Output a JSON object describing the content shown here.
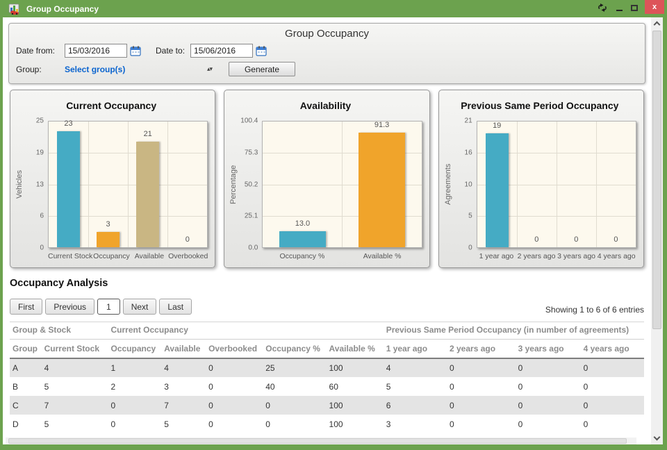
{
  "window": {
    "title": "Group Occupancy",
    "close_glyph": "x"
  },
  "icons": {
    "app": "bar-chart-with-car",
    "sync": "sync-arrows",
    "minimize": "minimize-dash",
    "maximize": "maximize-square",
    "close": "close-x",
    "calendar": "calendar",
    "select_spinner": "up-down-arrows",
    "scroll_up": "chevron-up",
    "scroll_down": "chevron-down"
  },
  "form": {
    "title": "Group Occupancy",
    "date_from_label": "Date from:",
    "date_from_value": "15/03/2016",
    "date_to_label": "Date to:",
    "date_to_value": "15/06/2016",
    "group_label": "Group:",
    "group_value": "Select group(s)",
    "spinner_glyph": "▴▾",
    "generate_label": "Generate"
  },
  "colors": {
    "titlebar_green": "#6ca24e",
    "close_red": "#dd5459",
    "teal": "#45abc4",
    "orange": "#f0a42b",
    "tan": "#c9b683",
    "plot_bg": "#fdf9ee",
    "link_blue": "#0b64cf",
    "row_alt": "#e4e4e4"
  },
  "chart_data": [
    {
      "type": "bar",
      "title": "Current Occupancy",
      "ylabel": "Vehicles",
      "categories": [
        "Current Stock",
        "Occupancy",
        "Available",
        "Overbooked"
      ],
      "values": [
        23,
        3,
        21,
        0
      ],
      "value_labels": [
        "23",
        "3",
        "21",
        "0"
      ],
      "colors": [
        "#45abc4",
        "#f0a42b",
        "#c9b683",
        "#45abc4"
      ],
      "ymax": 25,
      "ytick_labels": [
        "25",
        "19",
        "13",
        "6",
        "0"
      ],
      "grid": true,
      "legend": false
    },
    {
      "type": "bar",
      "title": "Availability",
      "ylabel": "Percentage",
      "categories": [
        "Occupancy %",
        "Available %"
      ],
      "values": [
        13.0,
        91.3
      ],
      "value_labels": [
        "13.0",
        "91.3"
      ],
      "colors": [
        "#45abc4",
        "#f0a42b"
      ],
      "ymax": 100.4,
      "ytick_labels": [
        "100.4",
        "75.3",
        "50.2",
        "25.1",
        "0.0"
      ],
      "grid": true,
      "legend": false
    },
    {
      "type": "bar",
      "title": "Previous Same Period Occupancy",
      "ylabel": "Agreements",
      "categories": [
        "1 year ago",
        "2 years ago",
        "3 years ago",
        "4 years ago"
      ],
      "values": [
        19,
        0,
        0,
        0
      ],
      "value_labels": [
        "19",
        "0",
        "0",
        "0"
      ],
      "colors": [
        "#45abc4",
        "#45abc4",
        "#45abc4",
        "#45abc4"
      ],
      "ymax": 21,
      "ytick_labels": [
        "21",
        "16",
        "10",
        "5",
        "0"
      ],
      "grid": true,
      "legend": false
    }
  ],
  "analysis": {
    "heading": "Occupancy Analysis",
    "pagination": [
      "First",
      "Previous",
      "1",
      "Next",
      "Last"
    ],
    "active_page": "1",
    "showing_text": "Showing 1 to 6 of 6 entries",
    "group_headers": [
      {
        "label": "Group & Stock",
        "span": 2
      },
      {
        "label": "Current Occupancy",
        "span": 5
      },
      {
        "label": "Previous Same Period Occupancy (in number of agreements)",
        "span": 4
      }
    ],
    "columns": [
      "Group",
      "Current Stock",
      "Occupancy",
      "Available",
      "Overbooked",
      "Occupancy %",
      "Available %",
      "1 year ago",
      "2 years ago",
      "3 years ago",
      "4 years ago"
    ],
    "rows": [
      [
        "A",
        "4",
        "1",
        "4",
        "0",
        "25",
        "100",
        "4",
        "0",
        "0",
        "0"
      ],
      [
        "B",
        "5",
        "2",
        "3",
        "0",
        "40",
        "60",
        "5",
        "0",
        "0",
        "0"
      ],
      [
        "C",
        "7",
        "0",
        "7",
        "0",
        "0",
        "100",
        "6",
        "0",
        "0",
        "0"
      ],
      [
        "D",
        "5",
        "0",
        "5",
        "0",
        "0",
        "100",
        "3",
        "0",
        "0",
        "0"
      ]
    ]
  }
}
